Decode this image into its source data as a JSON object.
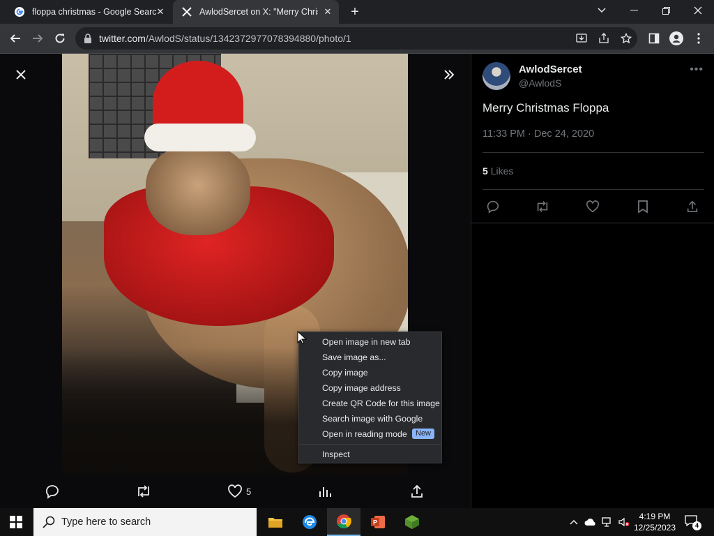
{
  "browser": {
    "tabs": [
      {
        "title": "floppa christmas - Google Searc",
        "active": false
      },
      {
        "title": "AwlodSercet on X: \"Merry Christ",
        "active": true
      }
    ],
    "url_host": "twitter.com",
    "url_path": "/AwlodS/status/1342372977078394880/photo/1"
  },
  "viewer": {
    "like_count": "5"
  },
  "tweet": {
    "display_name": "AwlodSercet",
    "handle": "@AwlodS",
    "text": "Merry Christmas Floppa",
    "timestamp": "11:33 PM · Dec 24, 2020",
    "likes_count": "5",
    "likes_label": "Likes"
  },
  "context_menu": {
    "items": [
      "Open image in new tab",
      "Save image as...",
      "Copy image",
      "Copy image address",
      "Create QR Code for this image",
      "Search image with Google",
      "Open in reading mode",
      "Inspect"
    ],
    "new_badge": "New"
  },
  "taskbar": {
    "search_placeholder": "Type here to search",
    "time": "4:19 PM",
    "date": "12/25/2023",
    "notification_count": "4"
  },
  "colors": {
    "x_dark_bg": "#000000",
    "secondary_text": "#71767b",
    "chrome_dark": "#35363a",
    "new_badge": "#8ab4f8"
  }
}
